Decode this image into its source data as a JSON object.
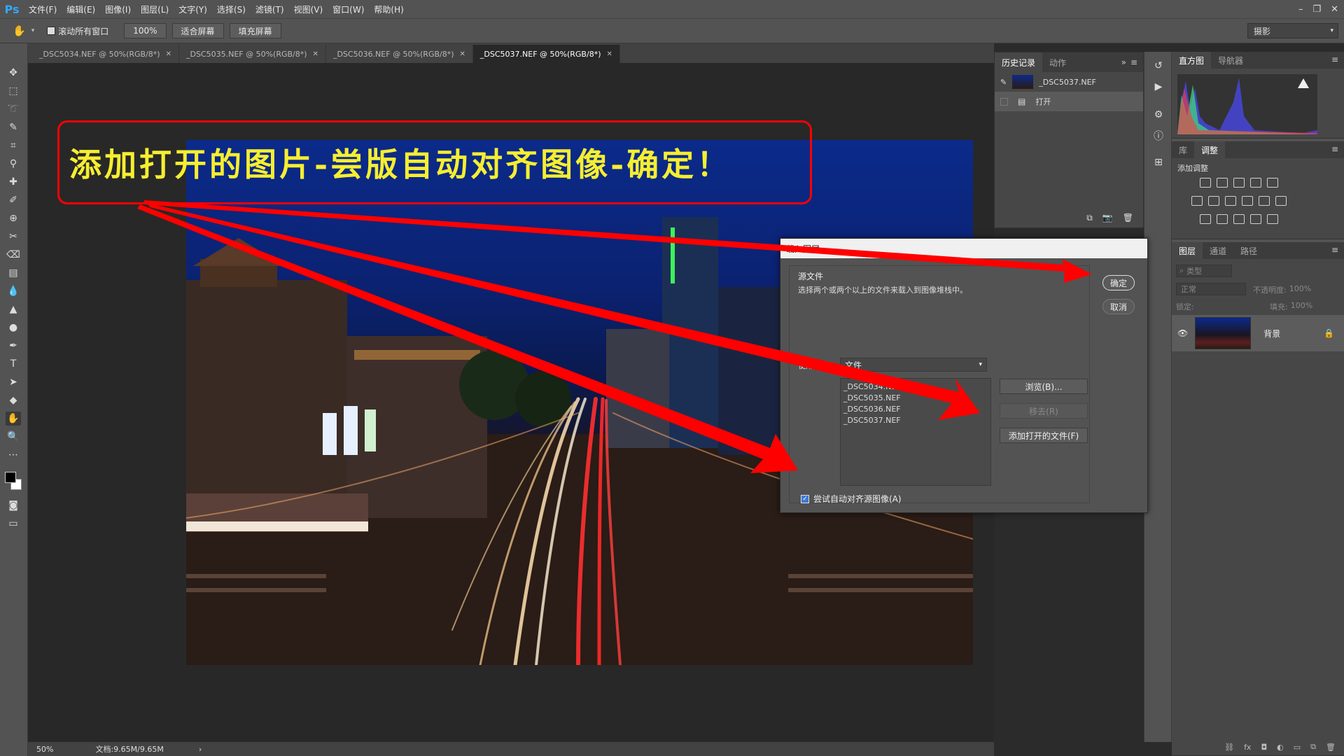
{
  "app": {
    "logo": "Ps",
    "menu": [
      "文件(F)",
      "编辑(E)",
      "图像(I)",
      "图层(L)",
      "文字(Y)",
      "选择(S)",
      "滤镜(T)",
      "视图(V)",
      "窗口(W)",
      "帮助(H)"
    ],
    "window_controls": [
      "–",
      "❐",
      "✕"
    ]
  },
  "options": {
    "scroll_all_label": "滚动所有窗口",
    "zoom_value": "100%",
    "fit_screen_label": "适合屏幕",
    "fill_screen_label": "填充屏幕",
    "workspace": "摄影"
  },
  "tabs": [
    {
      "label": "_DSC5034.NEF @ 50%(RGB/8*)",
      "active": false
    },
    {
      "label": "_DSC5035.NEF @ 50%(RGB/8*)",
      "active": false
    },
    {
      "label": "_DSC5036.NEF @ 50%(RGB/8*)",
      "active": false
    },
    {
      "label": "_DSC5037.NEF @ 50%(RGB/8*)",
      "active": true
    }
  ],
  "status": {
    "zoom": "50%",
    "doc_size": "文档:9.65M/9.65M"
  },
  "history_panel": {
    "tabs": [
      "历史记录",
      "动作"
    ],
    "snapshot_label": "_DSC5037.NEF",
    "steps": [
      "打开"
    ]
  },
  "right_panels": {
    "histogram_tabs": [
      "直方图",
      "导航器"
    ],
    "adjust_tabs": [
      "库",
      "调整"
    ],
    "add_adjustment_label": "添加调整",
    "layers_tabs": [
      "图层",
      "通道",
      "路径"
    ],
    "kind_filter": "类型",
    "blend_mode": "正常",
    "opacity_label": "不透明度:",
    "opacity_value": "100%",
    "lock_label": "锁定:",
    "fill_label": "填充:",
    "fill_value": "100%",
    "layer_name": "背景"
  },
  "dialog": {
    "title": "载入图层",
    "group_label": "源文件",
    "description": "选择两个或两个以上的文件来载入到图像堆栈中。",
    "use_label": "使用:",
    "use_value": "文件",
    "files": [
      "_DSC5034.NEF",
      "_DSC5035.NEF",
      "_DSC5036.NEF",
      "_DSC5037.NEF"
    ],
    "browse_label": "浏览(B)...",
    "remove_label": "移去(R)",
    "add_open_label": "添加打开的文件(F)",
    "ok_label": "确定",
    "cancel_label": "取消",
    "align_label": "尝试自动对齐源图像(A)",
    "align_checked": true
  },
  "annotation": {
    "text": "添加打开的图片-尝版自动对齐图像-确定！",
    "text_color": "#f6ee30",
    "border_color": "#ff0000"
  }
}
